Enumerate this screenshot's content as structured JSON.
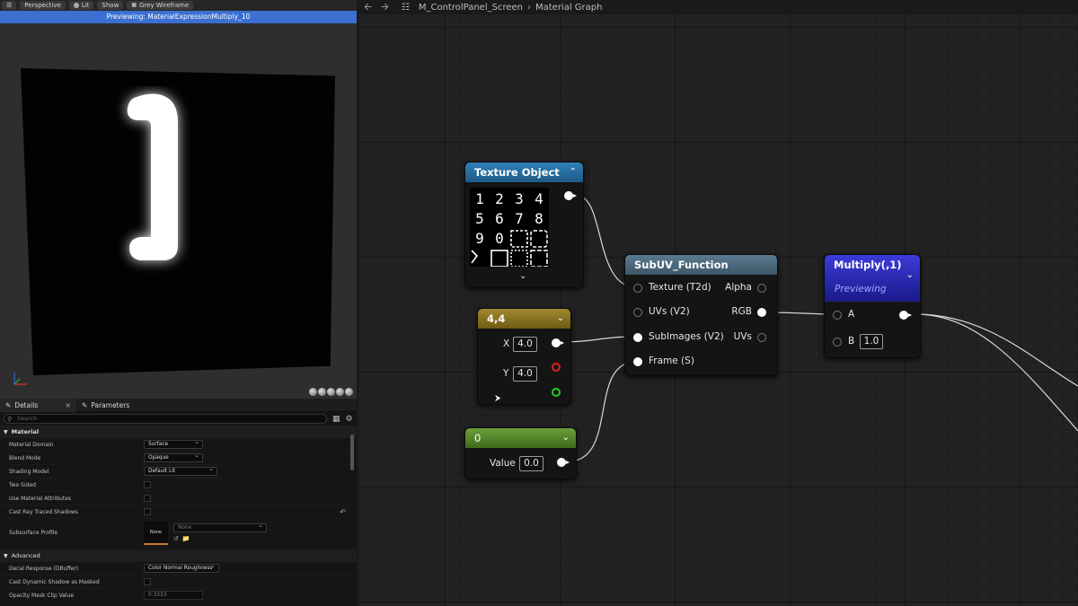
{
  "viewport": {
    "toolbar": [
      {
        "label": "",
        "icon": "hamburger-icon"
      },
      {
        "label": "Perspective"
      },
      {
        "label": "Lit"
      },
      {
        "label": "Show"
      },
      {
        "label": "Grey Wireframe"
      }
    ],
    "banner": "Previewing: MaterialExpressionMultiply_10",
    "preview_glyph": "1"
  },
  "details": {
    "tabs": [
      {
        "label": "Details"
      },
      {
        "label": "Parameters"
      }
    ],
    "search_placeholder": "Search",
    "material_section": "Material",
    "props": {
      "material_domain": {
        "label": "Material Domain",
        "value": "Surface"
      },
      "blend_mode": {
        "label": "Blend Mode",
        "value": "Opaque"
      },
      "shading_model": {
        "label": "Shading Model",
        "value": "Default Lit"
      },
      "two_sided": {
        "label": "Two Sided"
      },
      "use_material_attributes": {
        "label": "Use Material Attributes"
      },
      "cast_ray_traced_shadows": {
        "label": "Cast Ray Traced Shadows"
      },
      "subsurface_profile": {
        "label": "Subsurface Profile",
        "thumb": "None",
        "value": "None"
      }
    },
    "advanced_section": "Advanced",
    "advanced_props": {
      "decal_response": {
        "label": "Decal Response (DBuffer)",
        "value": "Color Normal Roughness"
      },
      "cast_dynamic_shadow": {
        "label": "Cast Dynamic Shadow as Masked"
      },
      "opacity_mask_clip": {
        "label": "Opacity Mask Clip Value",
        "value": "0.3333"
      }
    }
  },
  "graph": {
    "breadcrumb": [
      "M_ControlPanel_Screen",
      "Material Graph"
    ],
    "nodes": {
      "texture_object": {
        "title": "Texture Object",
        "header_color": "#2c6fa4",
        "glyphs": [
          "1",
          "2",
          "3",
          "4",
          "5",
          "6",
          "7",
          "8",
          "9",
          "0"
        ]
      },
      "vector2": {
        "title": "4,4",
        "header_color": "#8a7420",
        "x_label": "X",
        "x_value": "4.0",
        "y_label": "Y",
        "y_value": "4.0"
      },
      "scalar": {
        "title": "0",
        "header_color": "#5a8a2a",
        "value_label": "Value",
        "value": "0.0"
      },
      "subuv": {
        "title": "SubUV_Function",
        "header_color": "#4d6b80",
        "inputs": [
          "Texture (T2d)",
          "UVs (V2)",
          "SubImages (V2)",
          "Frame (S)"
        ],
        "outputs": [
          "Alpha",
          "RGB",
          "UVs"
        ]
      },
      "multiply": {
        "title": "Multiply(,1)",
        "header_color": "#2a2ac4",
        "subtitle": "Previewing",
        "a_label": "A",
        "b_label": "B",
        "b_value": "1.0"
      }
    }
  }
}
